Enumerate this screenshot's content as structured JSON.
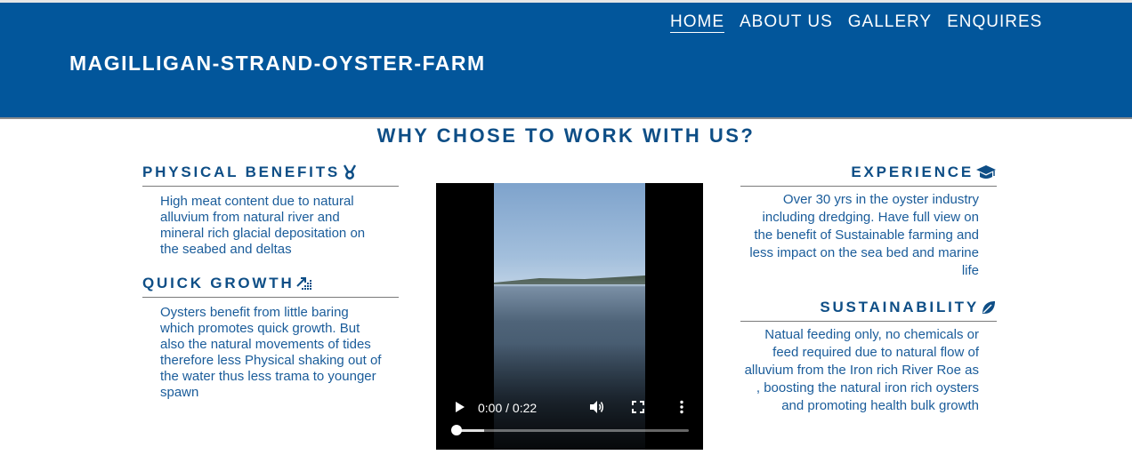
{
  "header": {
    "brand": "MAGILLIGAN-STRAND-OYSTER-FARM",
    "nav": [
      {
        "label": "HOME",
        "active": true
      },
      {
        "label": "ABOUT US"
      },
      {
        "label": "GALLERY"
      },
      {
        "label": "ENQUIRES"
      }
    ]
  },
  "main": {
    "title": "WHY CHOSE TO WORK WITH US?",
    "features": {
      "physical_benefits": {
        "title": "PHYSICAL BENEFITS",
        "icon": "medal-icon",
        "text": "High meat content due to natural alluvium from natural river and mineral rich glacial depositation on the seabed and deltas"
      },
      "quick_growth": {
        "title": "QUICK GROWTH",
        "icon": "growth-chart-icon",
        "text": "Oysters benefit from little baring which promotes quick growth. But also the natural movements of tides therefore less Physical shaking out of the water thus less trama to younger spawn"
      },
      "experience": {
        "title": "EXPERIENCE",
        "icon": "graduation-cap-icon",
        "text": "Over 30 yrs in the oyster industry including dredging. Have full view on the benefit of Sustainable farming and less impact on the sea bed and marine life"
      },
      "sustainability": {
        "title": "SUSTAINABILITY",
        "icon": "leaf-icon",
        "text": "Natual feeding only, no chemicals or feed required due to natural flow of alluvium from the Iron rich River Roe as , boosting the natural iron rich oysters and promoting health bulk growth"
      }
    },
    "video": {
      "time": "0:00 / 0:22",
      "progress": 0.0
    }
  },
  "colors": {
    "header_bg": "#02569b",
    "heading": "#0e4e86",
    "body_text": "#1a5c9a"
  }
}
